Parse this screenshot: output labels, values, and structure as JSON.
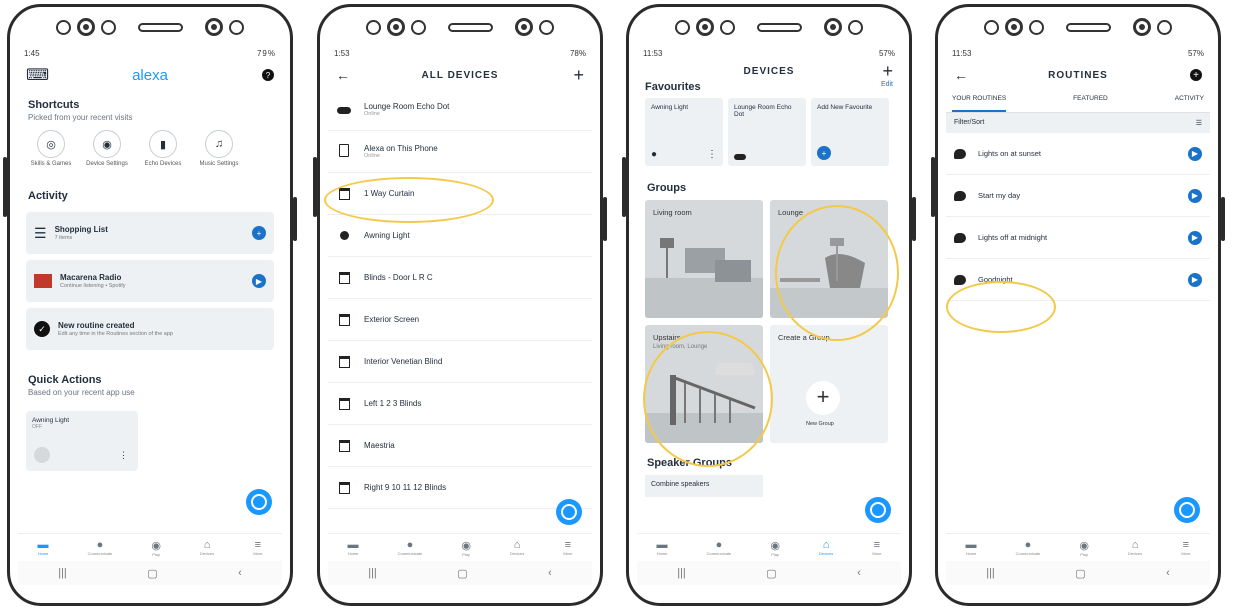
{
  "phone1": {
    "status": {
      "time": "1:45",
      "right": "79%"
    },
    "logo": "alexa",
    "shortcuts": {
      "title": "Shortcuts",
      "subtitle": "Picked from your recent visits",
      "items": [
        {
          "label": "Skills & Games",
          "icon": "target-icon"
        },
        {
          "label": "Device Settings",
          "icon": "speaker-icon"
        },
        {
          "label": "Echo Devices",
          "icon": "echo-icon"
        },
        {
          "label": "Music Settings",
          "icon": "music-note-icon"
        }
      ]
    },
    "activity": {
      "title": "Activity",
      "cards": [
        {
          "title": "Shopping List",
          "subtitle": "7 items"
        },
        {
          "title": "Macarena Radio",
          "subtitle": "Continue listening • Spotify"
        },
        {
          "title": "New routine created",
          "subtitle": "Edit any time in the Routines section of the app"
        }
      ]
    },
    "quick": {
      "title": "Quick Actions",
      "subtitle": "Based on your recent app use",
      "card_title": "Awning Light",
      "card_state": "OFF"
    },
    "nav": [
      "Home",
      "Communicate",
      "Play",
      "Devices",
      "More"
    ]
  },
  "phone2": {
    "status": {
      "time": "1:53",
      "right": "78%"
    },
    "title": "ALL DEVICES",
    "devices": [
      {
        "name": "Lounge Room Echo Dot",
        "sub": "Online"
      },
      {
        "name": "Alexa on This Phone",
        "sub": "Online"
      },
      {
        "name": "1 Way Curtain",
        "sub": ""
      },
      {
        "name": "Awning Light",
        "sub": ""
      },
      {
        "name": "Blinds - Door L R C",
        "sub": ""
      },
      {
        "name": "Exterior Screen",
        "sub": ""
      },
      {
        "name": "Interior Venetian Blind",
        "sub": ""
      },
      {
        "name": "Left 1 2 3 Blinds",
        "sub": ""
      },
      {
        "name": "Maestria",
        "sub": ""
      },
      {
        "name": "Right 9 10 11 12 Blinds",
        "sub": ""
      }
    ],
    "nav": [
      "Home",
      "Communicate",
      "Play",
      "Devices",
      "More"
    ]
  },
  "phone3": {
    "status": {
      "time": "11:53",
      "right": "57%"
    },
    "title": "DEVICES",
    "favourites": {
      "title": "Favourites",
      "edit": "Edit",
      "items": [
        "Awning Light",
        "Lounge Room Echo Dot",
        "Add New Favourite"
      ]
    },
    "groups": {
      "title": "Groups",
      "items": [
        {
          "name": "Living room",
          "sub": ""
        },
        {
          "name": "Lounge",
          "sub": ""
        },
        {
          "name": "Upstairs",
          "sub": "Living room, Lounge"
        },
        {
          "name": "Create a Group",
          "sub": "New Group"
        }
      ]
    },
    "speaker": {
      "title": "Speaker Groups",
      "item": "Combine speakers"
    },
    "nav": [
      "Home",
      "Communicate",
      "Play",
      "Devices",
      "More"
    ]
  },
  "phone4": {
    "status": {
      "time": "11:53",
      "right": "57%"
    },
    "title": "ROUTINES",
    "tabs": [
      "YOUR ROUTINES",
      "FEATURED",
      "ACTIVITY"
    ],
    "filter": "Filter/Sort",
    "routines": [
      "Lights on at sunset",
      "Start my day",
      "Lights off at midnight",
      "Goodnight"
    ],
    "nav": [
      "Home",
      "Communicate",
      "Play",
      "Devices",
      "More"
    ]
  }
}
